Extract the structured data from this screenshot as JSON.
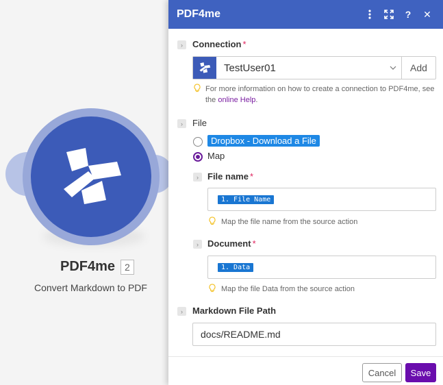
{
  "module": {
    "name": "PDF4me",
    "number": "2",
    "subtitle": "Convert Markdown to PDF"
  },
  "panel": {
    "title": "PDF4me",
    "header_icons": [
      "more-vertical-icon",
      "expand-icon",
      "help-icon",
      "close-icon"
    ],
    "help_glyph": "?",
    "close_glyph": "✕"
  },
  "connection": {
    "label": "Connection",
    "required_mark": "*",
    "selected": "TestUser01",
    "add_label": "Add",
    "hint_text": "For more information on how to create a connection to PDF4me, see the",
    "hint_link": "online Help",
    "hint_end": "."
  },
  "file": {
    "label": "File",
    "option_dropbox": "Dropbox - Download a File",
    "option_map": "Map",
    "selected": "Map"
  },
  "file_name": {
    "label": "File name",
    "required_mark": "*",
    "token": "1. File Name",
    "hint": "Map the file name from the source action"
  },
  "document": {
    "label": "Document",
    "required_mark": "*",
    "token": "1. Data",
    "hint": "Map the file Data from the source action"
  },
  "markdown_path": {
    "label": "Markdown File Path",
    "value": "docs/README.md"
  },
  "footer": {
    "cancel_label": "Cancel",
    "save_label": "Save"
  },
  "colors": {
    "header_blue": "#3f62c0",
    "module_blue": "#3c5bb8",
    "save_purple": "#6a0dad",
    "token_blue": "#1976d2",
    "required_red": "#e0245e"
  }
}
